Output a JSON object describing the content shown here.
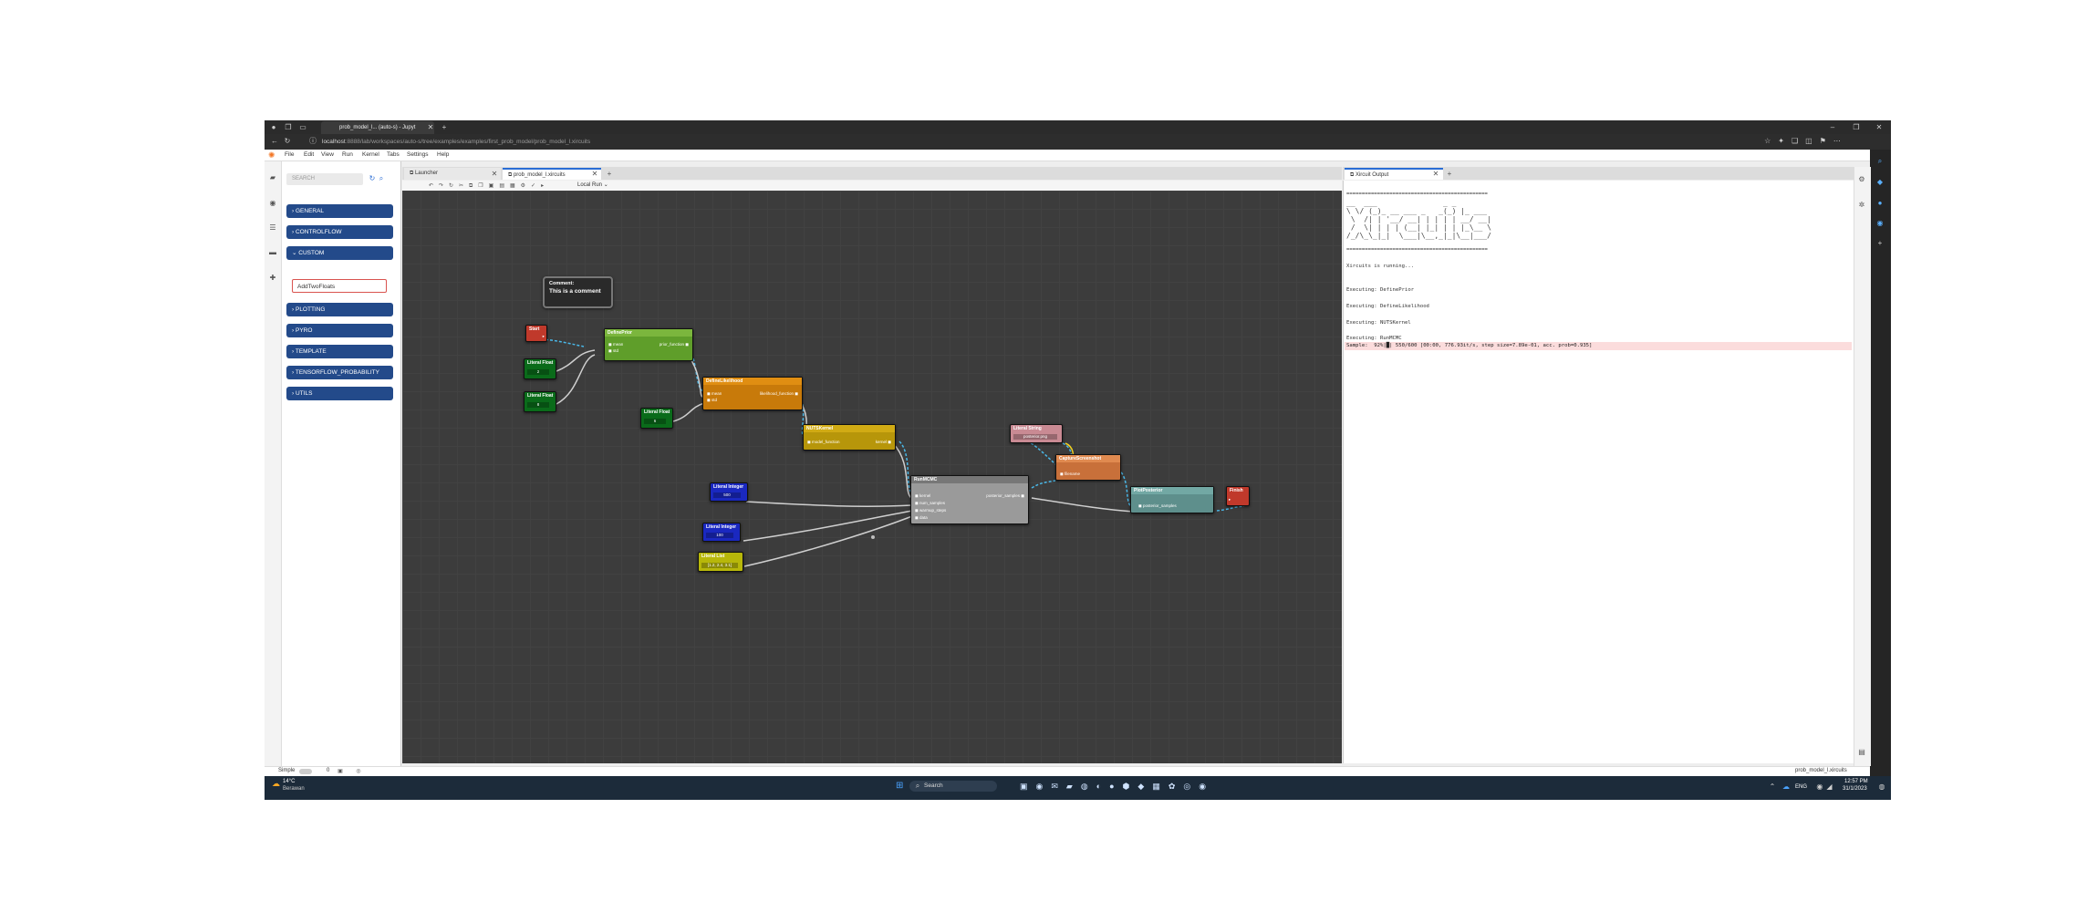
{
  "browser": {
    "tab_title": "prob_model_l... (auto-s) - Jupyt",
    "url_host": "localhost",
    "url_path": ":8888/lab/workspaces/auto-s/tree/examples/examples/first_prob_model/prob_model_l.xircuits"
  },
  "menu": [
    "File",
    "Edit",
    "View",
    "Run",
    "Kernel",
    "Tabs",
    "Settings",
    "Help"
  ],
  "sidebar": {
    "search_placeholder": "SEARCH",
    "categories_top": [
      "GENERAL",
      "CONTROLFLOW",
      "CUSTOM"
    ],
    "custom_item": "AddTwoFloats",
    "categories_bottom": [
      "PLOTTING",
      "PYRO",
      "TEMPLATE",
      "TENSORFLOW_PROBABILITY",
      "UTILS"
    ]
  },
  "doc_tabs": [
    "Launcher",
    "prob_model_l.xircuits"
  ],
  "toolbar": {
    "run_mode": "Local Run"
  },
  "output": {
    "tab": "Xircuit Output",
    "banner": [
      "==============================================",
      "__  ___               _ _       ",
      "\\ \\/ (_)_ __ ___ _   _(_) |_ ___ ",
      " \\  /| | '__/ __| | | | | __/ __|",
      " /  \\| | | | (__| |_| | | |_\\__ \\",
      "/_/\\_\\_|_|  \\___|\\__,_|_|\\__|___/",
      "=============================================="
    ],
    "running": "Xircuits is running...",
    "exec": [
      "Executing: DefinePrior",
      "Executing: DefineLikelihood",
      "Executing: NUTSKernel",
      "Executing: RunMCMC"
    ],
    "error_line": "Sample:  92%|█| 550/600 [00:00, 776.93it/s, step size=7.89e-01, acc. prob=0.935]"
  },
  "canvas": {
    "comment_title": "Comment:",
    "comment_text": "This is a comment",
    "start": "Start",
    "finish": "Finish",
    "define_prior": {
      "title": "DefinePrior",
      "ports": [
        "mean",
        "std"
      ],
      "out": "prior_function"
    },
    "literal_float_1": {
      "title": "Literal Float",
      "value": "2"
    },
    "literal_float_2": {
      "title": "Literal Float",
      "value": "8"
    },
    "literal_float_3": {
      "title": "Literal Float",
      "value": "6"
    },
    "define_likelihood": {
      "title": "DefineLikelihood",
      "ports": [
        "mean",
        "std"
      ],
      "out": "likelihood_function"
    },
    "nuts_kernel": {
      "title": "NUTSKernel",
      "ports": [
        "model_function"
      ],
      "out": "kernel"
    },
    "literal_string": {
      "title": "Literal String",
      "value": "posterior.png"
    },
    "capture_screenshot": {
      "title": "CaptureScreenshot",
      "ports": [
        "filename"
      ]
    },
    "run_mcmc": {
      "title": "RunMCMC",
      "ports": [
        "kernel",
        "num_samples",
        "warmup_steps",
        "data"
      ],
      "out": "posterior_samples"
    },
    "plot_posterior": {
      "title": "PlotPosterior",
      "ports": [
        "posterior_samples"
      ]
    },
    "literal_integer_1": {
      "title": "Literal Integer",
      "value": "500"
    },
    "literal_integer_2": {
      "title": "Literal Integer",
      "value": "100"
    },
    "literal_list": {
      "title": "Literal List",
      "value": "[1.2, 2.4, 3.1]"
    }
  },
  "status": {
    "mode": "Simple",
    "counts": "0",
    "file": "prob_model_l.xircuits"
  },
  "taskbar": {
    "weather_temp": "14°C",
    "weather_desc": "Berawan",
    "search": "Search",
    "lang": "ENG",
    "time": "12:57 PM",
    "date": "31/1/2023"
  },
  "colors": {
    "category": "#234a8a",
    "canvas": "#3c3c3c",
    "error_bg": "#fbdcdc"
  }
}
